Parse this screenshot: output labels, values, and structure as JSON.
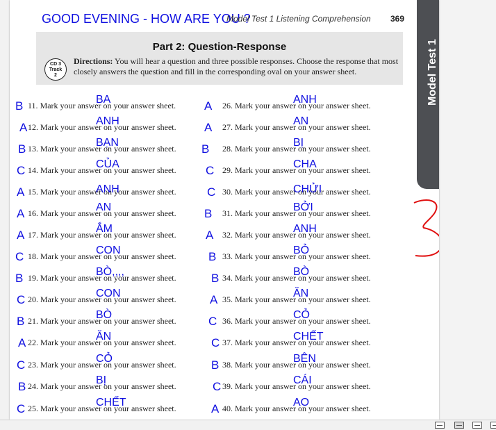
{
  "page": {
    "running_head": "Model Test 1  Listening Comprehension",
    "page_number": "369",
    "side_tab": "Model Test 1",
    "section_title": "Part 2: Question-Response",
    "cd_badge": [
      "CD 3",
      "Track",
      "2"
    ],
    "directions_label": "Directions:",
    "directions_text": "You will hear a question and three possible responses. Choose the response that most closely answers the question and fill in the corresponding oval on your answer sheet."
  },
  "annotations": {
    "greeting": "GOOD EVENING - HOW ARE YOU ?",
    "side_mark": "3"
  },
  "questions": [
    {
      "num": "11.",
      "text": "Mark your answer on your answer sheet.",
      "answer": "B",
      "word": "BA"
    },
    {
      "num": "12.",
      "text": "Mark your answer on your answer sheet.",
      "answer": "A",
      "word": "ANH"
    },
    {
      "num": "13.",
      "text": "Mark your answer on your answer sheet.",
      "answer": "B",
      "word": "BẠN"
    },
    {
      "num": "14.",
      "text": "Mark your answer on your answer sheet.",
      "answer": "C",
      "word": "CỦA"
    },
    {
      "num": "15.",
      "text": "Mark your answer on your answer sheet.",
      "answer": "A",
      "word": "ANH"
    },
    {
      "num": "16.",
      "text": "Mark your answer on your answer sheet.",
      "answer": "A",
      "word": "AN"
    },
    {
      "num": "17.",
      "text": "Mark your answer on your answer sheet.",
      "answer": "A",
      "word": "ẮM"
    },
    {
      "num": "18.",
      "text": "Mark your answer on your answer sheet.",
      "answer": "C",
      "word": "CON"
    },
    {
      "num": "19.",
      "text": "Mark your answer on your answer sheet.",
      "answer": "B",
      "word": "BÒ,,,,"
    },
    {
      "num": "20.",
      "text": "Mark your answer on your answer sheet.",
      "answer": "C",
      "word": "CON"
    },
    {
      "num": "21.",
      "text": "Mark your answer on your answer sheet.",
      "answer": "B",
      "word": "BÒ"
    },
    {
      "num": "22.",
      "text": "Mark your answer on your answer sheet.",
      "answer": "A",
      "word": "ĂN"
    },
    {
      "num": "23.",
      "text": "Mark your answer on your answer sheet.",
      "answer": "C",
      "word": "CỎ"
    },
    {
      "num": "24.",
      "text": "Mark your answer on your answer sheet.",
      "answer": "B",
      "word": "BỊ"
    },
    {
      "num": "25.",
      "text": "Mark your answer on your answer sheet.",
      "answer": "C",
      "word": "CHẾT"
    },
    {
      "num": "26.",
      "text": "Mark your answer on your answer sheet.",
      "answer": "A",
      "word": "ANH"
    },
    {
      "num": "27.",
      "text": "Mark your answer on your answer sheet.",
      "answer": "A",
      "word": "AN"
    },
    {
      "num": "28.",
      "text": "Mark your answer on your answer sheet.",
      "answer": "B",
      "word": "BỊ"
    },
    {
      "num": "29.",
      "text": "Mark your answer on your answer sheet.",
      "answer": "C",
      "word": "CHA"
    },
    {
      "num": "30.",
      "text": "Mark your answer on your answer sheet.",
      "answer": "C",
      "word": "CHỬI"
    },
    {
      "num": "31.",
      "text": "Mark your answer on your answer sheet.",
      "answer": "B",
      "word": "BỞI"
    },
    {
      "num": "32.",
      "text": "Mark your answer on your answer sheet.",
      "answer": "A",
      "word": "ANH"
    },
    {
      "num": "33.",
      "text": "Mark your answer on your answer sheet.",
      "answer": "B",
      "word": "BỎ"
    },
    {
      "num": "34.",
      "text": "Mark your answer on your answer sheet.",
      "answer": "B",
      "word": "BÒ"
    },
    {
      "num": "35.",
      "text": "Mark your answer on your answer sheet.",
      "answer": "A",
      "word": "ĂN"
    },
    {
      "num": "36.",
      "text": "Mark your answer on your answer sheet.",
      "answer": "C",
      "word": "CỎ"
    },
    {
      "num": "37.",
      "text": "Mark your answer on your answer sheet.",
      "answer": "C",
      "word": "CHẾT"
    },
    {
      "num": "38.",
      "text": "Mark your answer on your answer sheet.",
      "answer": "B",
      "word": "BÊN"
    },
    {
      "num": "39.",
      "text": "Mark your answer on your answer sheet.",
      "answer": "C",
      "word": "CÁI"
    },
    {
      "num": "40.",
      "text": "Mark your answer on your answer sheet.",
      "answer": "A",
      "word": "AO"
    }
  ],
  "colors": {
    "annotation": "#1010e0",
    "side_mark": "#e01010",
    "tab": "#4d4f53"
  },
  "status_bar": {
    "view_buttons": [
      "single-page-icon",
      "continuous-icon",
      "two-page-icon",
      "two-page-continuous-icon"
    ]
  }
}
